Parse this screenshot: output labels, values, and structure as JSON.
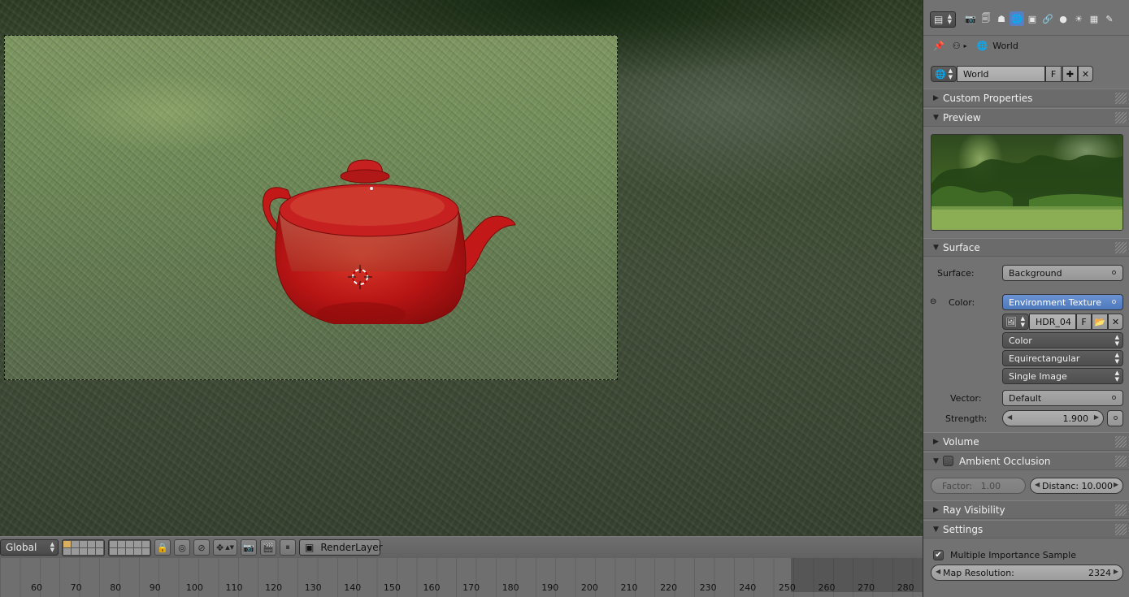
{
  "viewport": {
    "header": {
      "orientation": "Global",
      "render_layer": "RenderLayer"
    }
  },
  "timeline": {
    "ticks": [
      "60",
      "70",
      "80",
      "90",
      "100",
      "110",
      "120",
      "130",
      "140",
      "150",
      "160",
      "170",
      "180",
      "190",
      "200",
      "210",
      "220",
      "230",
      "240",
      "250",
      "260",
      "270",
      "280"
    ]
  },
  "properties": {
    "breadcrumb": {
      "context": "World"
    },
    "datablock": {
      "name": "World",
      "fake_user": "F"
    },
    "panels": {
      "custom_properties": "Custom Properties",
      "preview": "Preview",
      "surface": "Surface",
      "volume": "Volume",
      "ambient_occlusion": "Ambient Occlusion",
      "ray_visibility": "Ray Visibility",
      "settings": "Settings"
    },
    "surface": {
      "surface_label": "Surface:",
      "surface_value": "Background",
      "color_label": "Color:",
      "color_value": "Environment Texture",
      "image_name": "HDR_04",
      "image_fake": "F",
      "color_space": "Color",
      "projection": "Equirectangular",
      "source": "Single Image",
      "vector_label": "Vector:",
      "vector_value": "Default",
      "strength_label": "Strength:",
      "strength_value": "1.900"
    },
    "ambient_occlusion": {
      "factor": "Factor:   1.00",
      "distance": "Distanc: 10.000"
    },
    "settings": {
      "mis_label": "Multiple Importance Sample",
      "map_resolution_label": "Map Resolution:",
      "map_resolution_value": "2324"
    }
  },
  "colors": {
    "accent": "#5680c2",
    "teapot": "#c81414"
  }
}
